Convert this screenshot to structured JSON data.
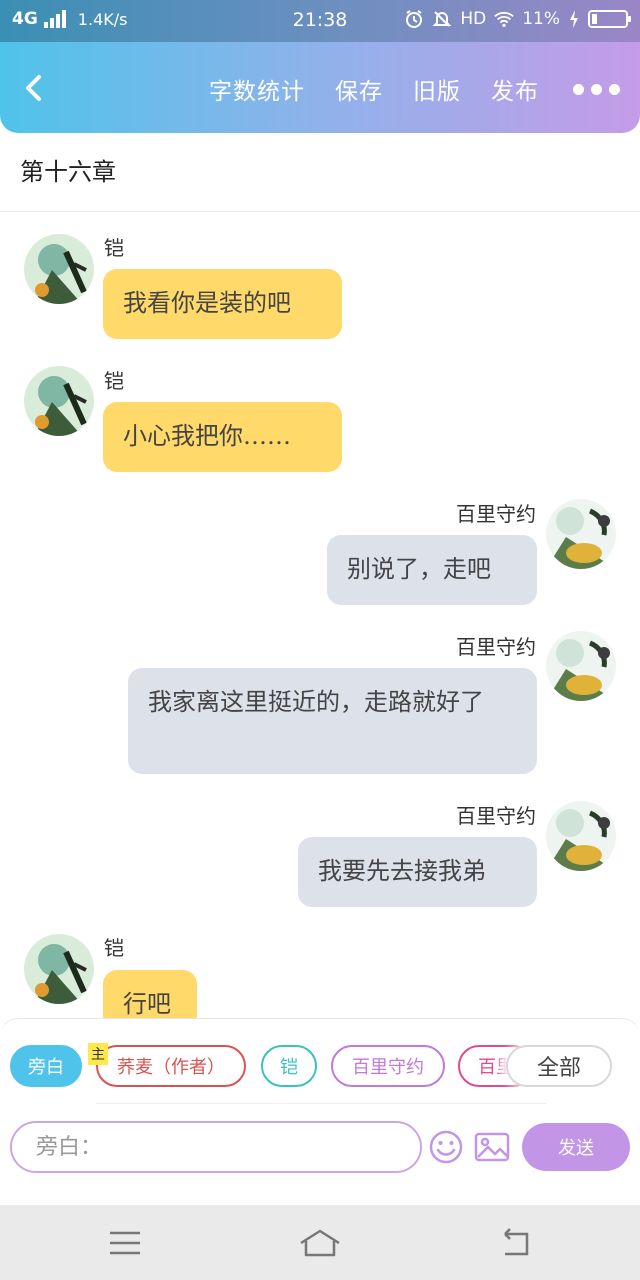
{
  "status_bar": {
    "network": "4G",
    "speed": "1.4K/s",
    "time": "21:38",
    "hd": "HD",
    "battery": "11%",
    "battery_level": 0.11
  },
  "app_bar": {
    "menu": [
      "字数统计",
      "保存",
      "旧版",
      "发布"
    ]
  },
  "chapter": {
    "title": "第十六章"
  },
  "messages": [
    {
      "sender": "铠",
      "text": "我看你是装的吧",
      "side": "left"
    },
    {
      "sender": "铠",
      "text": "小心我把你……",
      "side": "left"
    },
    {
      "sender": "百里守约",
      "text": "别说了，走吧",
      "side": "right"
    },
    {
      "sender": "百里守约",
      "text": "我家离这里挺近的，走路就好了",
      "side": "right"
    },
    {
      "sender": "百里守约",
      "text": "我要先去接我弟",
      "side": "right"
    },
    {
      "sender": "铠",
      "text": "行吧",
      "side": "left"
    }
  ],
  "roles": {
    "narration": "旁白",
    "main_badge": "主",
    "author": "荞麦（作者）",
    "kai": "铠",
    "baili": "百里守约",
    "baili_partial": "百里",
    "all": "全部"
  },
  "compose": {
    "placeholder": "旁白：",
    "send": "发送"
  },
  "colors": {
    "header_gradient_start": "#4fc3ea",
    "header_gradient_end": "#c49ce8",
    "bubble_left": "#ffd96a",
    "bubble_right": "#dde2ea",
    "send_button": "#c295e6"
  }
}
